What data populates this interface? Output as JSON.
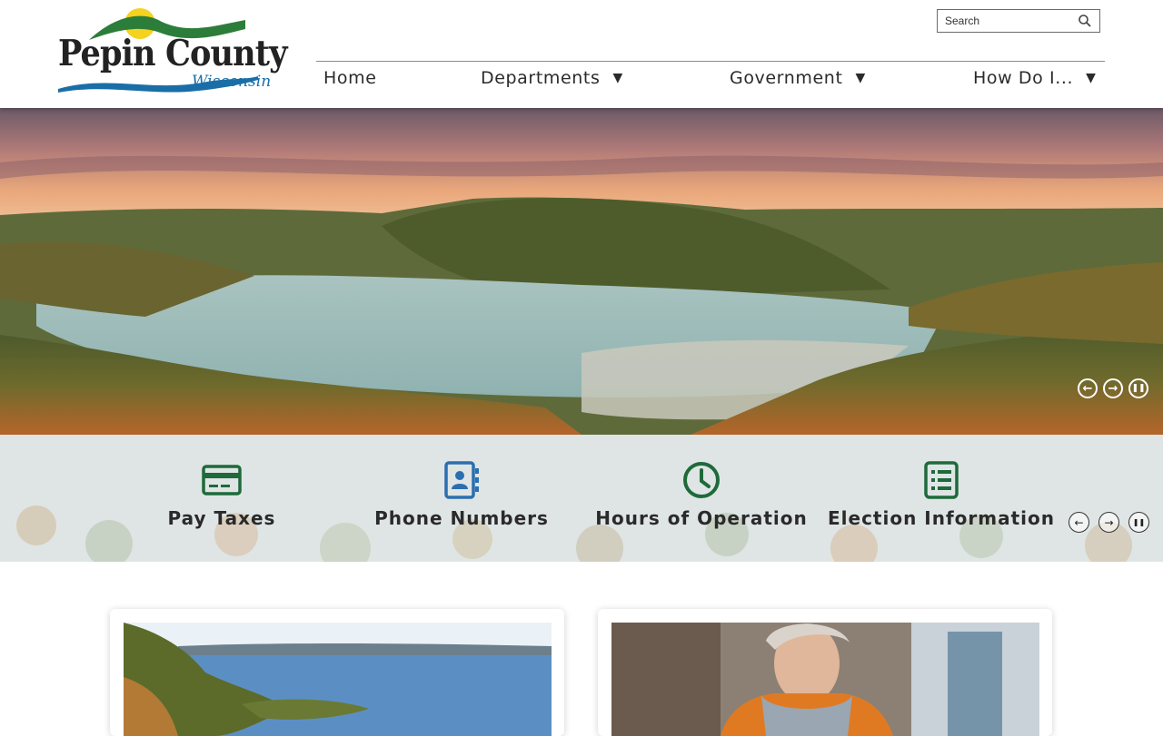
{
  "logo": {
    "line1": "Pepin County",
    "line2": "Wisconsin"
  },
  "search": {
    "placeholder": "Search",
    "icon": "search-icon"
  },
  "nav": {
    "items": [
      {
        "label": "Home",
        "dropdown": false
      },
      {
        "label": "Departments",
        "dropdown": true
      },
      {
        "label": "Government",
        "dropdown": true
      },
      {
        "label": "How Do I...",
        "dropdown": true
      }
    ],
    "caret": "▼"
  },
  "hero_controls": {
    "prev": "←",
    "next": "→",
    "pause": "❚❚"
  },
  "quick_links": [
    {
      "label": "Pay Taxes",
      "icon": "credit-card-icon",
      "color": "#1e6a3b"
    },
    {
      "label": "Phone Numbers",
      "icon": "address-book-icon",
      "color": "#2a6fb0"
    },
    {
      "label": "Hours of Operation",
      "icon": "clock-icon",
      "color": "#1e6a3b"
    },
    {
      "label": "Election Information",
      "icon": "list-icon",
      "color": "#1e6a3b"
    }
  ],
  "quick_controls": {
    "prev": "←",
    "next": "→",
    "pause": "❚❚"
  },
  "colors": {
    "brand_green": "#1e6a3b",
    "brand_blue": "#1a6ea8",
    "nav_text": "#2b2b2b"
  }
}
